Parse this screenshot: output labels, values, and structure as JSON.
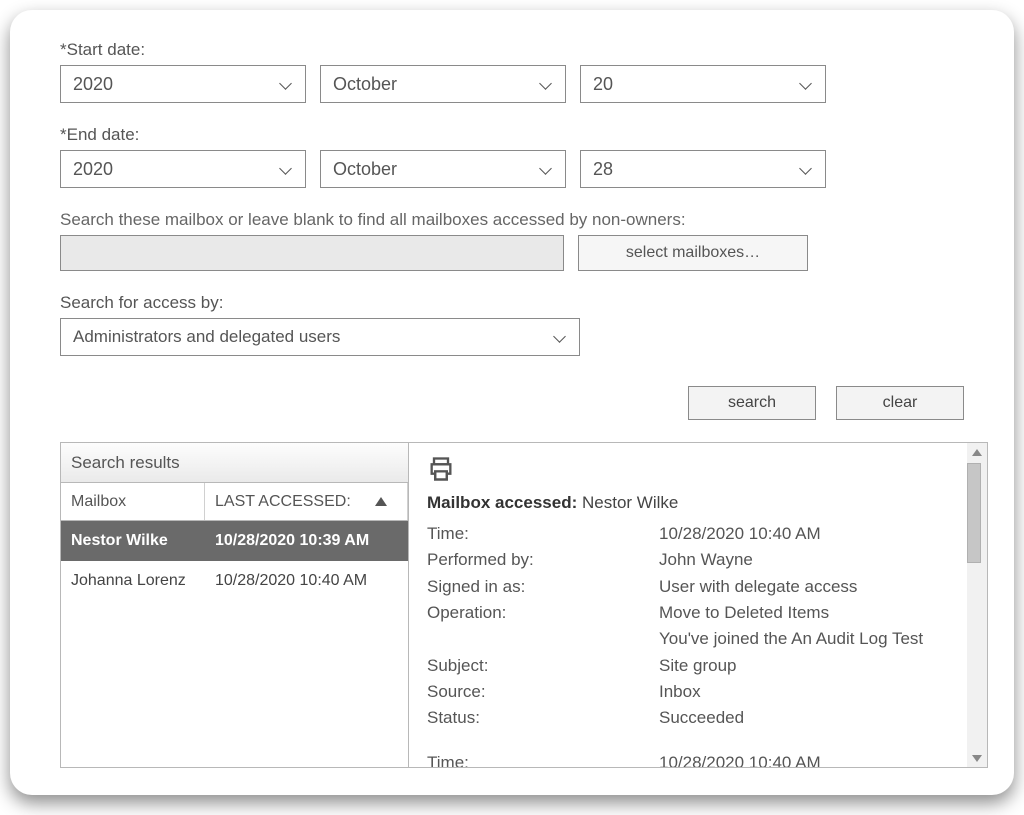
{
  "labels": {
    "start_date": "*Start date:",
    "end_date": "*End date:",
    "mailbox_hint": "Search these mailbox or leave blank to find all mailboxes accessed by non-owners:",
    "select_mailboxes": "select mailboxes…",
    "access_by": "Search for access by:",
    "search": "search",
    "clear": "clear",
    "results_title": "Search results",
    "col_mailbox": "Mailbox",
    "col_last": "LAST ACCESSED:"
  },
  "start": {
    "year": "2020",
    "month": "October",
    "day": "20"
  },
  "end": {
    "year": "2020",
    "month": "October",
    "day": "28"
  },
  "access_select": "Administrators and delegated users",
  "rows": [
    {
      "mailbox": "Nestor Wilke",
      "last": "10/28/2020 10:39 AM",
      "selected": true
    },
    {
      "mailbox": "Johanna Lorenz",
      "last": "10/28/2020 10:40 AM",
      "selected": false
    }
  ],
  "detail": {
    "header_label": "Mailbox accessed:",
    "header_value": "Nestor Wilke",
    "fields": [
      {
        "k": "Time:",
        "v": "10/28/2020 10:40 AM"
      },
      {
        "k": "Performed by:",
        "v": "John Wayne"
      },
      {
        "k": "Signed in as:",
        "v": "User with delegate access"
      },
      {
        "k": "Operation:",
        "v": "Move to Deleted Items"
      },
      {
        "k": "",
        "v": "You've joined the An Audit Log Test"
      },
      {
        "k": "Subject:",
        "v": "Site group"
      },
      {
        "k": "Source:",
        "v": "Inbox"
      },
      {
        "k": "Status:",
        "v": "Succeeded"
      }
    ],
    "extra": {
      "k": "Time:",
      "v": "10/28/2020 10:40 AM"
    }
  }
}
